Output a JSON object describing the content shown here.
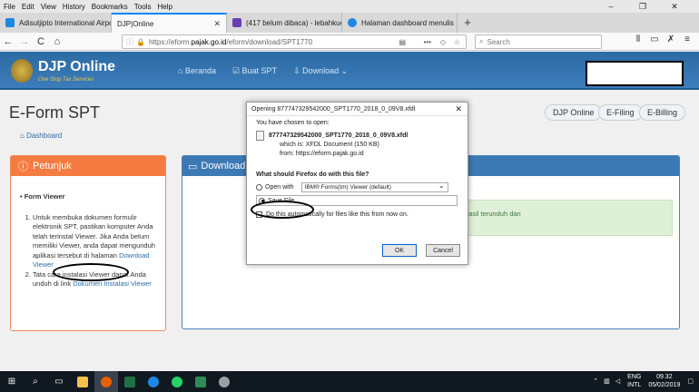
{
  "menubar": {
    "items": [
      "File",
      "Edit",
      "View",
      "History",
      "Bookmarks",
      "Tools",
      "Help"
    ]
  },
  "window_controls": {
    "minimize": "–",
    "restore": "❐",
    "close": "✕"
  },
  "tabs": [
    {
      "label": "Adisutjipto International Airpo",
      "color": "#1e88e5"
    },
    {
      "label": "DJP|Online",
      "color": "#c9a227"
    },
    {
      "label": "(417 belum dibaca) - lebahkue",
      "color": "#6a3fb5"
    },
    {
      "label": "Halaman dashboard menulis",
      "color": "#1e88e5"
    }
  ],
  "tab_close": "✕",
  "new_tab": "+",
  "nav": {
    "back": "←",
    "forward": "→",
    "reload": "C",
    "home": "⌂",
    "url_prefix": "https://eform.",
    "url_domain": "pajak.go.id",
    "url_rest": "/eform/download/SPT1770",
    "search_placeholder": "Search",
    "menu_dots": "•••"
  },
  "site": {
    "brand": "DJP Online",
    "tagline": "One Stop Tax Services",
    "menu": [
      "⌂ Beranda",
      "☑ Buat SPT",
      "⇩ Download ⌄"
    ],
    "page_title": "E-Form SPT",
    "breadcrumb": "Dashboard",
    "pills": [
      "DJP Online",
      "E-Filing",
      "E-Billing"
    ]
  },
  "petunjuk": {
    "title": "Petunjuk",
    "section": "Form Viewer",
    "item1_text": "Untuk membuka dokumen formulir elektronik SPT, pastikan komputer Anda telah terinstal Viewer. Jika Anda belum memiliki Viewer, anda dapat mengunduh aplikasi tersebut di halaman",
    "item1_link": "Download Viewer",
    "item2_text": "Tata cara instalasi Viewer dapat Anda unduh di link",
    "item2_link": "Dokumen Instalasi Viewer"
  },
  "download_panel": {
    "title": "Download Fo",
    "notice": "hasil terunduh dan"
  },
  "dialog": {
    "title": "Opening 877747329542000_SPT1770_2018_0_09V8.xfdl",
    "intro": "You have chosen to open:",
    "filename": "877747329542000_SPT1770_2018_0_09V8.xfdl",
    "which_is": "which is:  XFDL Document (150 KB)",
    "from": "from:  https://eform.pajak.go.id",
    "question": "What should Firefox do with this file?",
    "open_with_label": "Open with",
    "open_with_app": "IBM® Forms(tm) Viewer (default)",
    "save_file_label": "Save File",
    "auto_label": "Do this automatically for files like this from now on.",
    "ok": "OK",
    "cancel": "Cancel"
  },
  "taskbar": {
    "lang": "ENG",
    "layout": "INTL",
    "time": "09.32",
    "date": "05/02/2019"
  }
}
